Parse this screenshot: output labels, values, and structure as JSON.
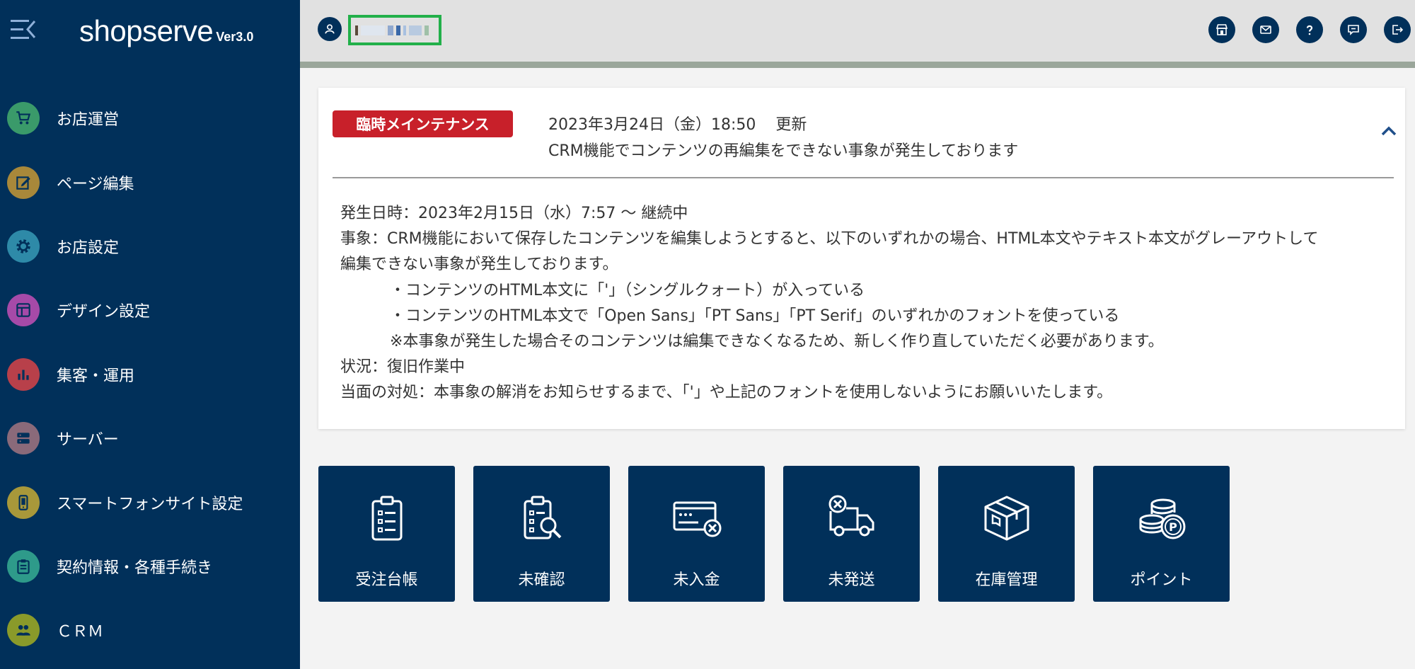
{
  "app": {
    "logo_text": "shopserve",
    "version": "Ver3.0"
  },
  "sidebar": {
    "items": [
      {
        "label": "お店運営",
        "icon": "cart-icon",
        "color": "#3a9a6a"
      },
      {
        "label": "ページ編集",
        "icon": "edit-icon",
        "color": "#a8883a"
      },
      {
        "label": "お店設定",
        "icon": "gear-icon",
        "color": "#2e8aa8"
      },
      {
        "label": "デザイン設定",
        "icon": "layout-icon",
        "color": "#a64aa8"
      },
      {
        "label": "集客・運用",
        "icon": "bar-chart-icon",
        "color": "#b8404a"
      },
      {
        "label": "サーバー",
        "icon": "server-icon",
        "color": "#8a6a7a"
      },
      {
        "label": "スマートフォンサイト設定",
        "icon": "smartphone-icon",
        "color": "#a8983a"
      },
      {
        "label": "契約情報・各種手続き",
        "icon": "clipboard-icon",
        "color": "#2e9a8a"
      },
      {
        "label": "ＣＲＭ",
        "icon": "people-icon",
        "color": "#8a9a2a"
      }
    ]
  },
  "header": {
    "user_icon": "user-icon",
    "icons": [
      "store-icon",
      "mail-icon",
      "help-icon",
      "chat-icon",
      "logout-icon"
    ]
  },
  "notice": {
    "badge": "臨時メインテナンス",
    "date": "2023年3月24日（金）18:50",
    "updated": "更新",
    "summary": "CRM機能でコンテンツの再編集をできない事象が発生しております",
    "body": [
      "発生日時：2023年2月15日（水）7:57 ～ 継続中",
      "事象：CRM機能において保存したコンテンツを編集しようとすると、以下のいずれかの場合、HTML本文やテキスト本文がグレーアウトして",
      "編集できない事象が発生しております。",
      "・コンテンツのHTML本文に「'」（シングルクォート）が入っている",
      "・コンテンツのHTML本文で「Open Sans」「PT Sans」「PT Serif」のいずれかのフォントを使っている",
      "※本事象が発生した場合そのコンテンツは編集できなくなるため、新しく作り直していただく必要があります。",
      "状況：復旧作業中",
      "当面の対処：本事象の解消をお知らせするまで、「'」や上記のフォントを使用しないようにお願いいたします。"
    ]
  },
  "tiles": [
    {
      "label": "受注台帳",
      "icon": "order-ledger-icon"
    },
    {
      "label": "未確認",
      "icon": "unconfirmed-icon"
    },
    {
      "label": "未入金",
      "icon": "unpaid-icon"
    },
    {
      "label": "未発送",
      "icon": "unshipped-icon"
    },
    {
      "label": "在庫管理",
      "icon": "inventory-icon"
    },
    {
      "label": "ポイント",
      "icon": "points-icon"
    }
  ],
  "colors": {
    "navy": "#01305a",
    "badge_red": "#c8202a",
    "highlight_green": "#22b04a"
  }
}
